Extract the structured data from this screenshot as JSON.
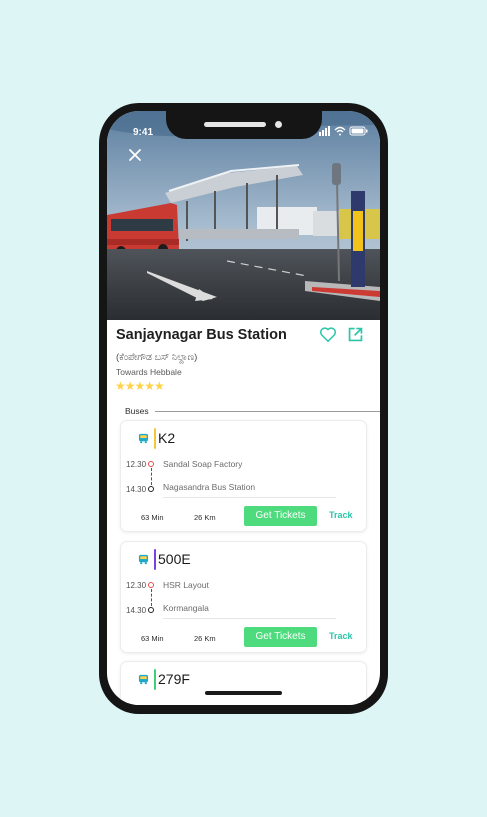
{
  "status_bar": {
    "time": "9:41"
  },
  "station": {
    "name": "Sanjaynagar Bus Station",
    "local_name": "(ಕೆಂಪೇಗೌಡ ಬಸ್ ನಿಲ್ದಾಣ)",
    "towards": "Towards Hebbale",
    "rating_stars": "★★★★★",
    "rating": 5
  },
  "section": {
    "buses_label": "Buses"
  },
  "buses": [
    {
      "route": "K2",
      "route_color": "#f2c935",
      "from_time": "12.30",
      "from_stop": "Sandal Soap Factory",
      "to_time": "14.30",
      "to_stop": "Nagasandra Bus Station",
      "duration": "63 Min",
      "distance": "26 Km",
      "button_label": "Get Tickets",
      "track_label": "Track"
    },
    {
      "route": "500E",
      "route_color": "#7b3fe4",
      "from_time": "12.30",
      "from_stop": "HSR Layout",
      "to_time": "14.30",
      "to_stop": "Kormangala",
      "duration": "63 Min",
      "distance": "26 Km",
      "button_label": "Get Tickets",
      "track_label": "Track"
    },
    {
      "route": "279F",
      "route_color": "#3ecf7a"
    }
  ],
  "colors": {
    "accent": "#2bc6a8",
    "ticket_button": "#4ddb7d",
    "star": "#ffd24a",
    "background": "#def5f5"
  },
  "icons": {
    "close": "close-icon",
    "favorite": "heart-icon",
    "share": "external-link-icon",
    "bus": "bus-icon"
  }
}
